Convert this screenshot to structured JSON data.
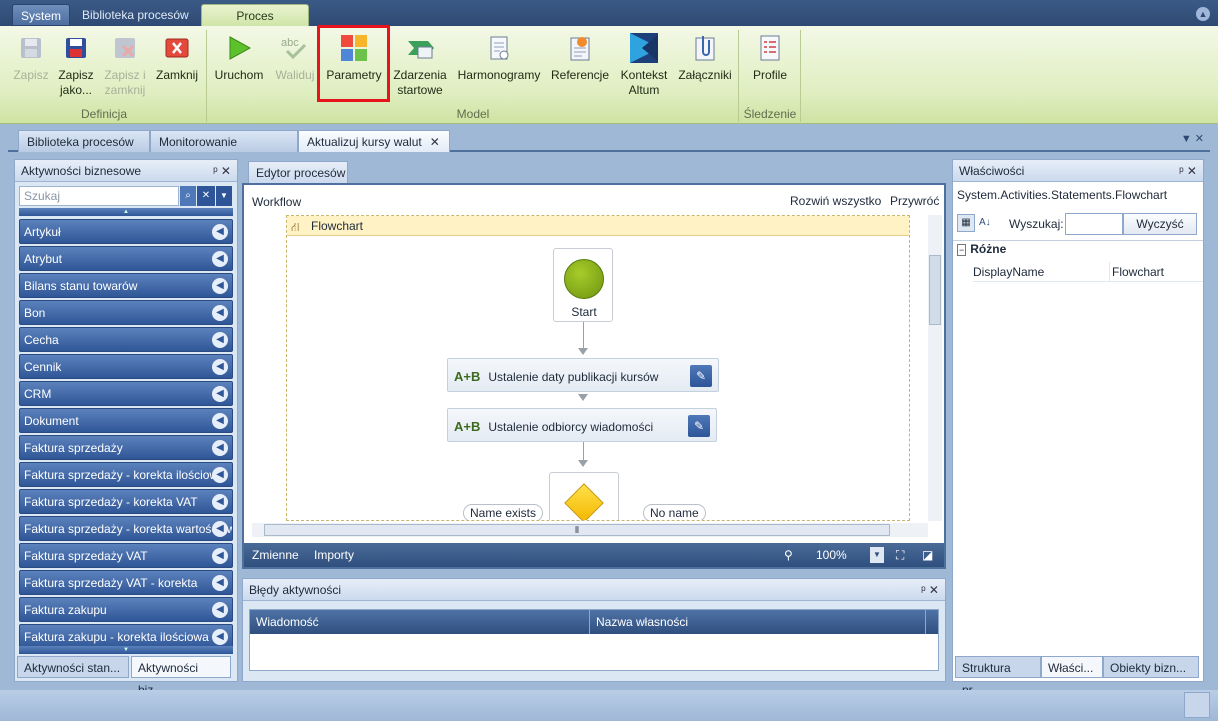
{
  "ribbon": {
    "top_tabs": [
      "System",
      "Biblioteka procesów",
      "Proces"
    ],
    "buttons": [
      {
        "label": "Zapisz",
        "icon": "save-icon",
        "enabled": false
      },
      {
        "label": "Zapisz jako...",
        "icon": "save-as-icon",
        "enabled": true
      },
      {
        "label": "Zapisz i zamknij",
        "icon": "save-close-icon",
        "enabled": false
      },
      {
        "label": "Zamknij",
        "icon": "close-icon",
        "enabled": true
      },
      {
        "label": "Uruchom",
        "icon": "play-icon",
        "enabled": true
      },
      {
        "label": "Waliduj",
        "icon": "spellcheck-icon",
        "enabled": false
      },
      {
        "label": "Parametry",
        "icon": "parameters-icon",
        "enabled": true
      },
      {
        "label": "Zdarzenia startowe",
        "icon": "start-events-icon",
        "enabled": true
      },
      {
        "label": "Harmonogramy",
        "icon": "schedule-icon",
        "enabled": true
      },
      {
        "label": "Referencje",
        "icon": "references-icon",
        "enabled": true
      },
      {
        "label": "Kontekst Altum",
        "icon": "altum-context-icon",
        "enabled": true
      },
      {
        "label": "Załączniki",
        "icon": "attachment-icon",
        "enabled": true
      },
      {
        "label": "Profile",
        "icon": "profile-icon",
        "enabled": true
      }
    ],
    "groups": [
      "Definicja",
      "Model",
      "Śledzenie"
    ]
  },
  "doc_tabs": [
    "Biblioteka procesów",
    "Monitorowanie proc...",
    "Aktualizuj kursy walut"
  ],
  "left_panel": {
    "title": "Aktywności biznesowe",
    "search_placeholder": "Szukaj",
    "categories": [
      "Artykuł",
      "Atrybut",
      "Bilans stanu towarów",
      "Bon",
      "Cecha",
      "Cennik",
      "CRM",
      "Dokument",
      "Faktura sprzedaży",
      "Faktura sprzedaży - korekta ilościowa",
      "Faktura sprzedaży - korekta VAT",
      "Faktura sprzedaży - korekta wartościowa",
      "Faktura sprzedaży VAT",
      "Faktura sprzedaży VAT - korekta",
      "Faktura zakupu",
      "Faktura zakupu - korekta ilościowa"
    ],
    "bottom_tabs": [
      "Aktywności stan...",
      "Aktywności biz..."
    ]
  },
  "editor": {
    "tab": "Edytor procesów",
    "breadcrumb": "Workflow",
    "expand_all": "Rozwiń wszystko",
    "collapse": "Przywróć",
    "flowchart_label": "Flowchart",
    "start_label": "Start",
    "activities": [
      "Ustalenie daty publikacji kursów",
      "Ustalenie odbiorcy wiadomości"
    ],
    "decision_true": "Name exists",
    "decision_false": "No name",
    "footer_vars": "Zmienne",
    "footer_imports": "Importy",
    "zoom": "100%"
  },
  "errors_panel": {
    "title": "Błędy aktywności",
    "columns": [
      "Wiadomość",
      "Nazwa własności"
    ]
  },
  "properties_panel": {
    "title": "Właściwości",
    "type_name": "System.Activities.Statements.Flowchart",
    "search_label": "Wyszukaj:",
    "clear_button": "Wyczyść",
    "category": "Różne",
    "rows": [
      {
        "name": "DisplayName",
        "value": "Flowchart"
      }
    ],
    "bottom_tabs": [
      "Struktura pr...",
      "Właści...",
      "Obiekty bizn..."
    ]
  },
  "colors": {
    "accent_red": "#e8141c",
    "nav_blue": "#2f5697",
    "ribbon_green": "#dfeec0"
  }
}
